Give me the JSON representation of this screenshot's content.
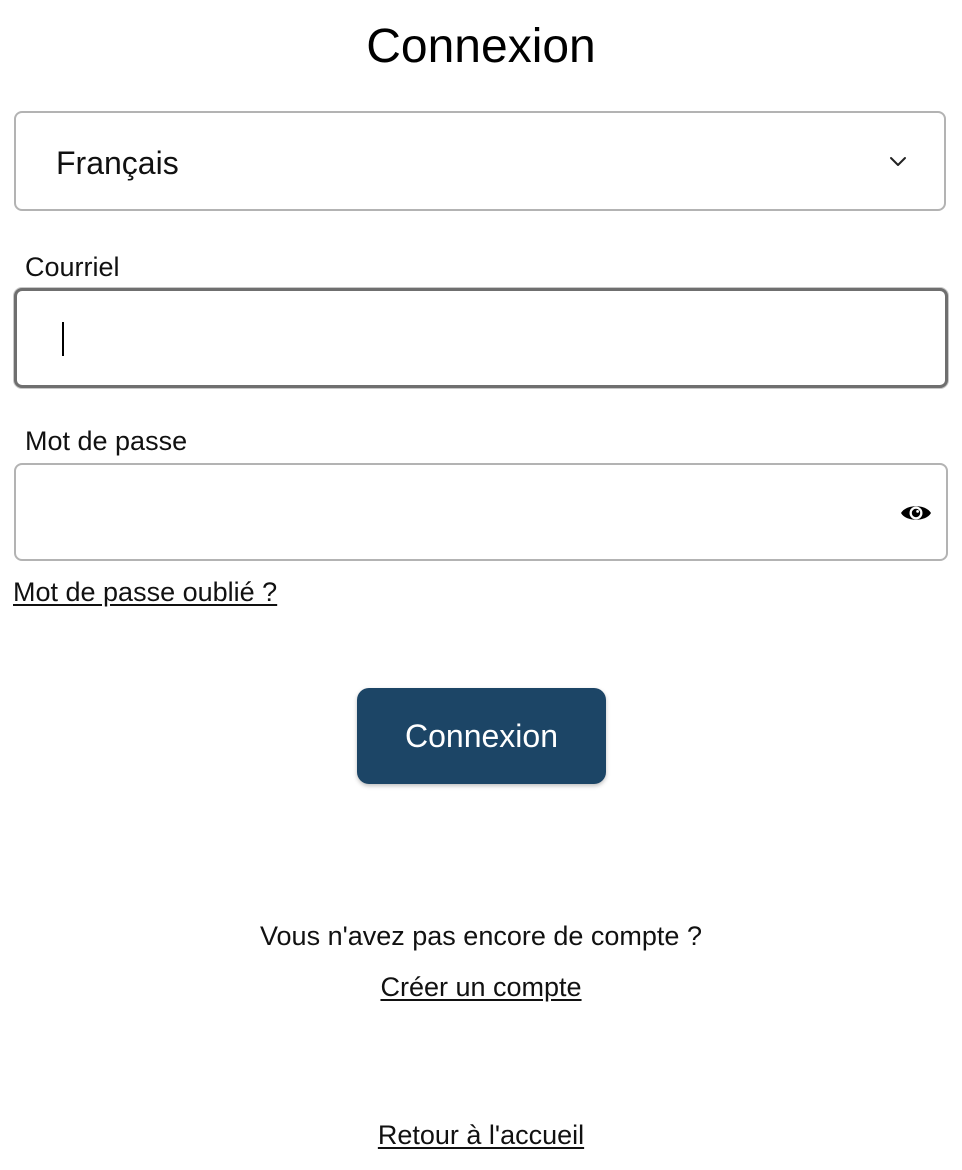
{
  "page": {
    "title": "Connexion"
  },
  "language_select": {
    "value": "Français",
    "icon": "chevron-down-icon"
  },
  "email": {
    "label": "Courriel",
    "value": "",
    "placeholder": ""
  },
  "password": {
    "label": "Mot de passe",
    "value": "",
    "placeholder": "",
    "toggle_icon": "eye-icon"
  },
  "links": {
    "forgot_password": "Mot de passe oublié ?",
    "create_account": "Créer un compte",
    "back_home": "Retour à l'accueil"
  },
  "submit": {
    "label": "Connexion"
  },
  "signup_prompt": "Vous n'avez pas encore de compte ?",
  "colors": {
    "primary_button": "#1c4566",
    "border": "#b3b3b3",
    "focused_border": "#6f6f6f"
  }
}
